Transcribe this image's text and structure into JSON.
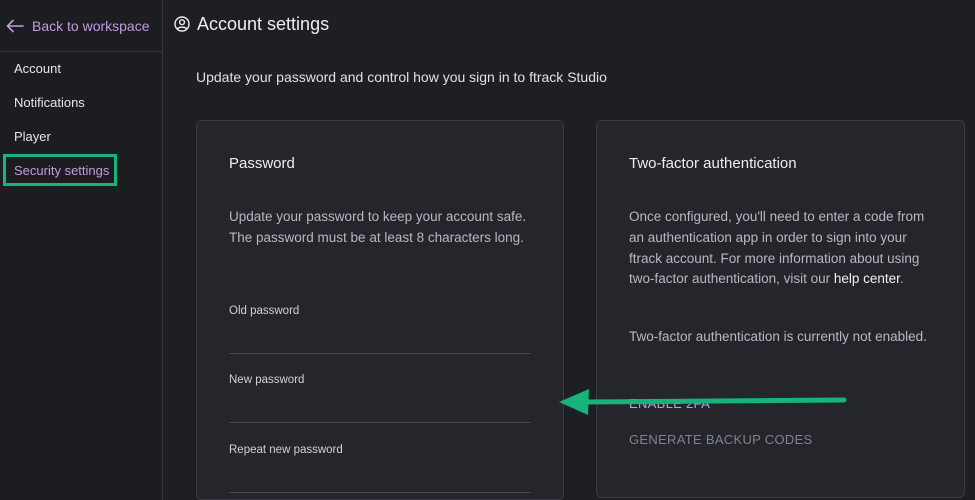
{
  "sidebar": {
    "back_label": "Back to workspace",
    "items": [
      {
        "label": "Account"
      },
      {
        "label": "Notifications"
      },
      {
        "label": "Player"
      },
      {
        "label": "Security settings"
      }
    ],
    "active_item": "Security settings"
  },
  "header": {
    "title": "Account settings",
    "icon": "account-circle-icon"
  },
  "main": {
    "subtitle": "Update your password and control how you sign in to ftrack Studio"
  },
  "password_card": {
    "title": "Password",
    "description": "Update your password to keep your account safe. The password must be at least 8 characters long.",
    "fields": [
      {
        "label": "Old password",
        "value": ""
      },
      {
        "label": "New password",
        "value": ""
      },
      {
        "label": "Repeat new password",
        "value": ""
      }
    ]
  },
  "tfa_card": {
    "title": "Two-factor authentication",
    "description_prefix": "Once configured, you'll need to enter a code from an authentication app in order to sign into your ftrack account. For more information about using two-factor authentication, visit our ",
    "help_link": "help center",
    "description_suffix": ".",
    "status": "Two-factor authentication is currently not enabled.",
    "enable_label": "ENABLE 2FA",
    "backup_label": "GENERATE BACKUP CODES"
  },
  "colors": {
    "accent": "#c49be0",
    "highlight": "#17b37a",
    "background": "#1d1f24",
    "card": "#24262c"
  }
}
